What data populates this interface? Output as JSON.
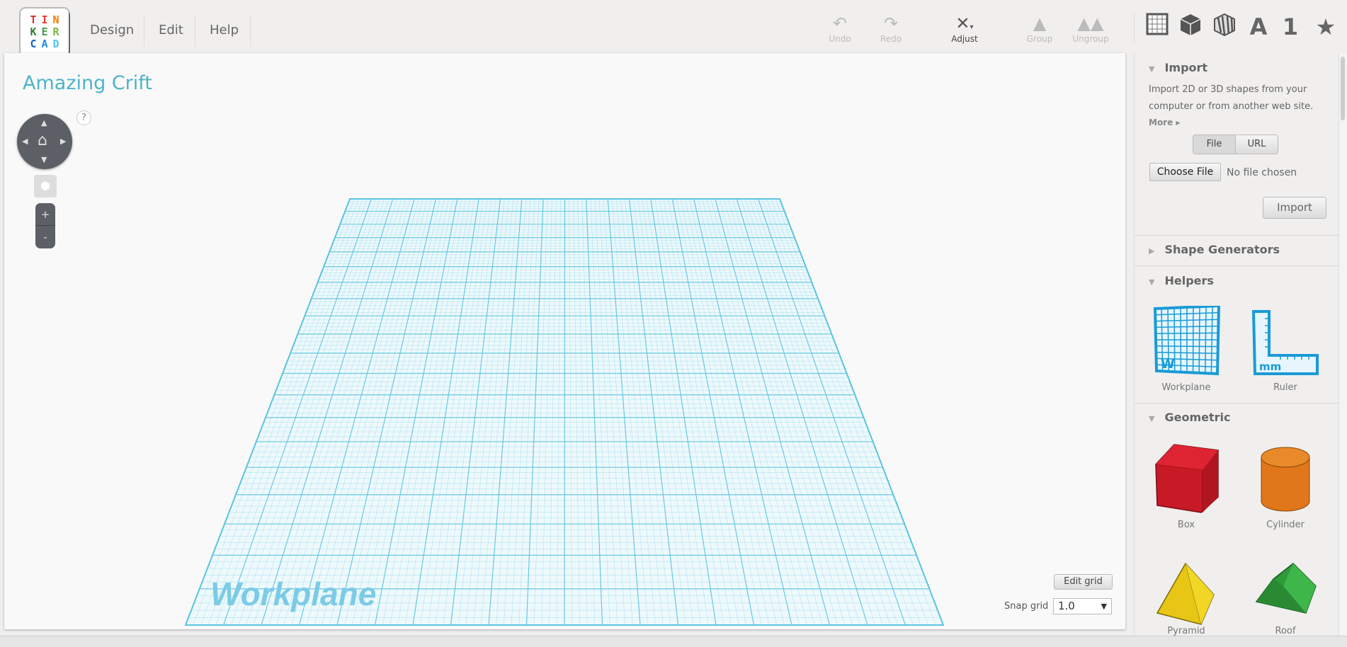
{
  "logo": {
    "letters": [
      "T",
      "I",
      "N",
      "K",
      "E",
      "R",
      "C",
      "A",
      "D"
    ],
    "colors": [
      "#d32f2f",
      "#e53935",
      "#f57c00",
      "#2e7d32",
      "#43a047",
      "#7cb342",
      "#1565c0",
      "#1e88e5",
      "#4fc3f7"
    ]
  },
  "menu": [
    "Design",
    "Edit",
    "Help"
  ],
  "toolbar": {
    "undo": "Undo",
    "redo": "Redo",
    "adjust": "Adjust",
    "group": "Group",
    "ungroup": "Ungroup"
  },
  "right_icons": [
    "workplane-grid-icon",
    "solid-cube-icon",
    "hole-cube-icon",
    "text-icon",
    "number-icon",
    "star-icon"
  ],
  "right_icon_text": {
    "text": "A",
    "number": "1",
    "star": "★"
  },
  "design": {
    "title": "Amazing Crift",
    "help": "?",
    "zoom_in": "+",
    "zoom_out": "-",
    "workplane_label": "Workplane",
    "edit_grid": "Edit grid",
    "snap_label": "Snap grid",
    "snap_value": "1.0",
    "grid_color": "#5bc3df"
  },
  "panel": {
    "import": {
      "title": "Import",
      "desc1": "Import 2D or 3D shapes from your",
      "desc2": "computer or from another web site.",
      "more": "More ▸",
      "file_tab": "File",
      "url_tab": "URL",
      "choose_file": "Choose File",
      "no_file": "No file chosen",
      "import_btn": "Import"
    },
    "shape_generators": "Shape Generators",
    "helpers": {
      "title": "Helpers",
      "items": [
        "Workplane",
        "Ruler"
      ]
    },
    "geometric": {
      "title": "Geometric",
      "items": [
        "Box",
        "Cylinder",
        "Pyramid",
        "Roof"
      ]
    }
  }
}
